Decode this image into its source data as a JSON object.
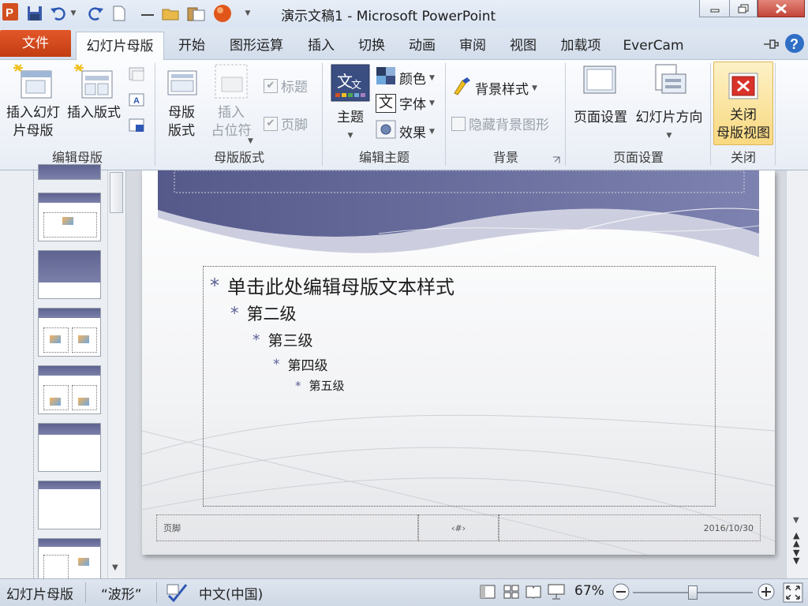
{
  "app": {
    "title": "演示文稿1 - Microsoft PowerPoint",
    "app_icon_letter": "P"
  },
  "qat": [
    "save-icon",
    "undo-icon",
    "redo-icon",
    "new-icon",
    "minus-icon",
    "open-icon",
    "paste-icon",
    "record-icon"
  ],
  "tabs": {
    "file": "文件",
    "items": [
      "幻灯片母版",
      "开始",
      "图形运算",
      "插入",
      "切换",
      "动画",
      "审阅",
      "视图",
      "加载项",
      "EverCam"
    ],
    "active": "幻灯片母版"
  },
  "ribbon": {
    "edit_master": {
      "label": "编辑母版",
      "insert_master": "插入幻灯\n片母版",
      "insert_layout": "插入版式"
    },
    "master_layout": {
      "label": "母版版式",
      "master_layout_btn": "母版\n版式",
      "insert_placeholder": "插入\n占位符",
      "title_chk": "标题",
      "footer_chk": "页脚"
    },
    "edit_theme": {
      "label": "编辑主题",
      "theme": "主题",
      "colors": "颜色",
      "fonts": "字体",
      "effects": "效果",
      "font_glyph": "文"
    },
    "background": {
      "label": "背景",
      "bg_styles": "背景样式",
      "hide_bg": "隐藏背景图形"
    },
    "page_setup": {
      "label": "页面设置",
      "page_setup_btn": "页面设置",
      "orientation": "幻灯片方向"
    },
    "close": {
      "label": "关闭",
      "close_btn": "关闭\n母版视图"
    }
  },
  "slide": {
    "levels": [
      "单击此处编辑母版文本样式",
      "第二级",
      "第三级",
      "第四级",
      "第五级"
    ],
    "bullet": "*",
    "footer_text": "页脚",
    "date_text": "2016/10/30",
    "slide_number": "‹#›"
  },
  "status": {
    "view": "幻灯片母版",
    "theme": "“波形”",
    "language": "中文(中国)",
    "zoom": "67%",
    "zoom_fraction": 0.5
  },
  "colors": {
    "file_tab": "#d24f20",
    "wave_dark": "#5a5e8c",
    "close_hl": "#fbe59a"
  }
}
